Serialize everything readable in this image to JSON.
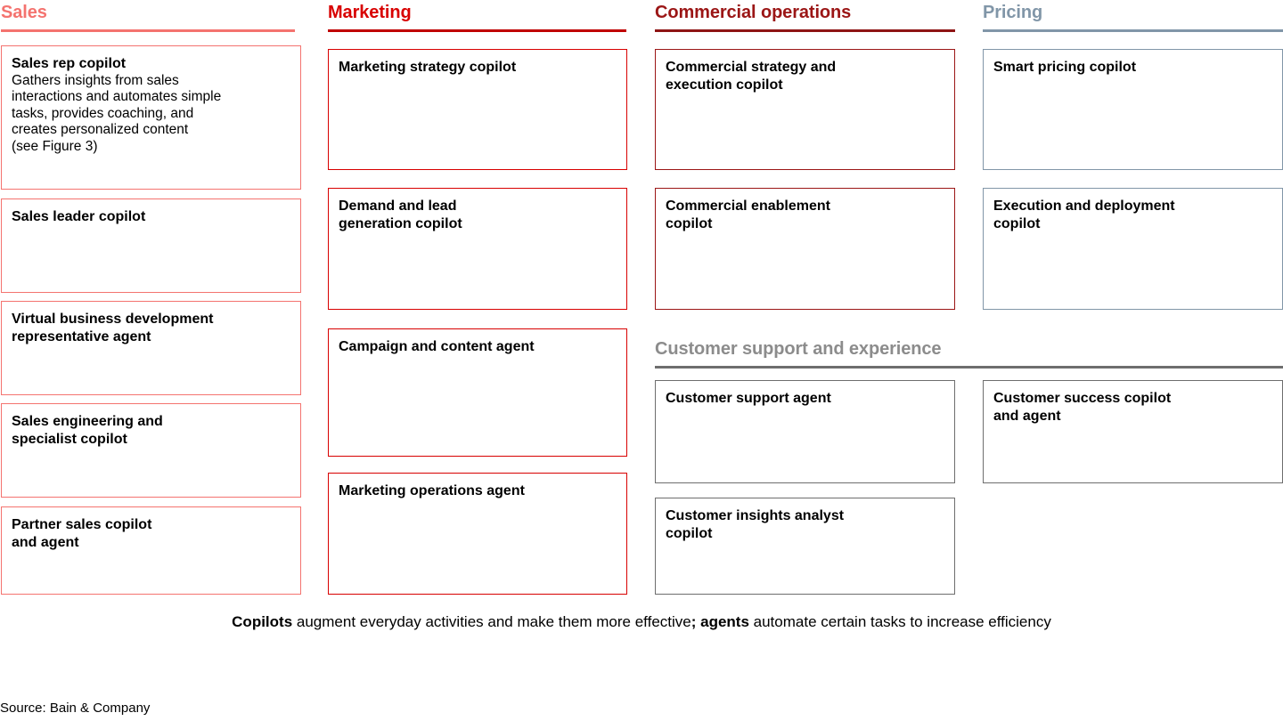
{
  "figure": {
    "footnote": {
      "bold1": "Copilots",
      "text1": " augment everyday activities and make them more effective",
      "bold2": "; agents",
      "text2": " automate certain tasks to increase efficiency"
    },
    "source": "Source: Bain & Company"
  },
  "colors": {
    "sales": "#f4736f",
    "marketing": "#d80000",
    "marketing_rule": "#c00000",
    "commercial_operations": "#9b1616",
    "pricing": "#8196a8",
    "support": "#6e6e6e",
    "support_title": "#8c8c8c",
    "text": "#000000",
    "background": "#ffffff"
  },
  "sections": {
    "sales": {
      "title": "Sales",
      "cards": [
        {
          "title": "Sales rep copilot",
          "desc": "Gathers insights from sales\ninteractions and automates simple\ntasks, provides coaching, and\ncreates personalized content\n(see Figure 3)"
        },
        {
          "title": "Sales leader copilot",
          "desc": ""
        },
        {
          "title": "Virtual business development\nrepresentative agent",
          "desc": ""
        },
        {
          "title": "Sales engineering and\nspecialist copilot",
          "desc": ""
        },
        {
          "title": "Partner sales copilot\nand agent",
          "desc": ""
        }
      ]
    },
    "marketing": {
      "title": "Marketing",
      "cards": [
        {
          "title": "Marketing strategy copilot",
          "desc": ""
        },
        {
          "title": "Demand and lead\ngeneration copilot",
          "desc": ""
        },
        {
          "title": "Campaign and content agent",
          "desc": ""
        },
        {
          "title": "Marketing operations agent",
          "desc": ""
        }
      ]
    },
    "commercial_operations": {
      "title": "Commercial operations",
      "cards": [
        {
          "title": "Commercial strategy and\nexecution copilot",
          "desc": ""
        },
        {
          "title": "Commercial enablement\ncopilot",
          "desc": ""
        }
      ]
    },
    "pricing": {
      "title": "Pricing",
      "cards": [
        {
          "title": "Smart pricing copilot",
          "desc": ""
        },
        {
          "title": "Execution and deployment\ncopilot",
          "desc": ""
        }
      ]
    },
    "customer_support": {
      "title": "Customer support and experience",
      "cards": [
        {
          "title": "Customer support agent",
          "desc": ""
        },
        {
          "title": "Customer success copilot\nand agent",
          "desc": ""
        },
        {
          "title": "Customer insights analyst\ncopilot",
          "desc": ""
        }
      ]
    }
  }
}
